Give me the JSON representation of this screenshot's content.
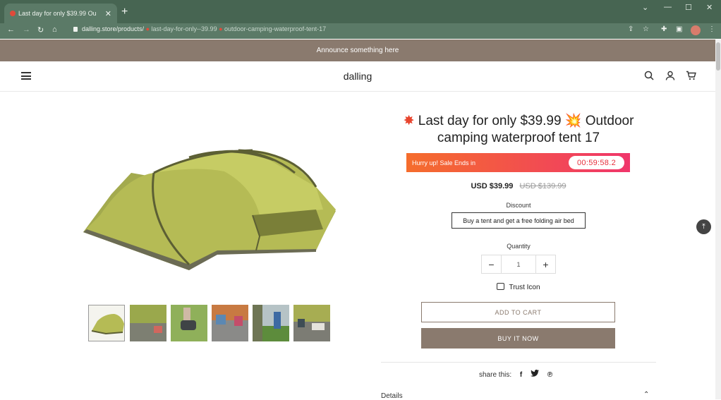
{
  "browser": {
    "tab_title": "Last day for only $39.99 Ou",
    "url_host": "dalling.store/products/",
    "url_path": "last-day-for-only--39.99",
    "url_tail": "outdoor-camping-waterproof-tent-17"
  },
  "store": {
    "announcement": "Announce something here",
    "brand": "dalling"
  },
  "product": {
    "title": "Last day for only $39.99 💥 Outdoor camping waterproof tent 17",
    "sale_label": "Hurry up! Sale Ends in",
    "countdown": "00:59:58.2",
    "price_now": "USD $39.99",
    "price_was": "USD $139.99",
    "discount_label": "Discount",
    "discount_option": "Buy a tent and get a free folding air bed",
    "quantity_label": "Quantity",
    "quantity_value": "1",
    "trust_label": "Trust Icon",
    "add_to_cart": "ADD TO CART",
    "buy_now": "BUY IT NOW",
    "share_label": "share this:",
    "details_label": "Details"
  },
  "colors": {
    "browser_frame": "#476552",
    "accent": "#8a7a6e",
    "sale_gradient_start": "#f56d2c",
    "sale_gradient_end": "#f0366b"
  }
}
